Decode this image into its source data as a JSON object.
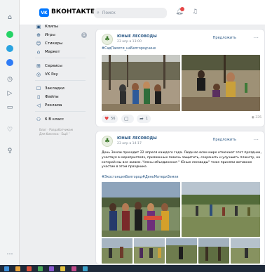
{
  "header": {
    "logo_mark": "VK",
    "logo_text": "ВКОНТАКТЕ",
    "search_placeholder": "Поиск",
    "icons": [
      "search-icon",
      "bell-icon",
      "music-icon"
    ]
  },
  "left_menu": {
    "items": [
      {
        "label": "Клипы",
        "icon": "clips-icon"
      },
      {
        "label": "Игры",
        "icon": "gamepad-icon",
        "badge": "1"
      },
      {
        "label": "Стикеры",
        "icon": "sticker-icon"
      },
      {
        "label": "Маркет",
        "icon": "market-icon"
      },
      {
        "label": "Сервисы",
        "icon": "services-icon"
      },
      {
        "label": "VK Pay",
        "icon": "vkpay-icon"
      },
      {
        "label": "Закладки",
        "icon": "bookmark-icon"
      },
      {
        "label": "Файлы",
        "icon": "file-icon"
      },
      {
        "label": "Реклама",
        "icon": "ads-icon"
      },
      {
        "label": "6 В класс",
        "icon": "group-icon"
      }
    ],
    "footer": "Блог · Разработчикам\nДля бизнеса · Ещё ˅"
  },
  "posts": [
    {
      "author": "ЮНЫЕ ЛЕСОВОДЫ",
      "date": "23 апр в 13:00",
      "suggest_label": "Предложить",
      "tags": "#СадПамяти_наБелгородчине",
      "text": "",
      "likes": "56",
      "comments": "",
      "shares": "1",
      "views": "335"
    },
    {
      "author": "ЮНЫЕ ЛЕСОВОДЫ",
      "date": "23 апр в 14:17",
      "suggest_label": "Предложить",
      "text": "День Земли проходит 22 апреля каждого года. Люди во всем мире отмечают этот праздник, участвуя в мероприятиях, призванных помочь защитить, сохранить и улучшить планету, на которой мы все живем. Члены объединения \" Юные лесоводы\" тоже приняли активное участие в этом празднике.",
      "tags": "#ЭкостанцияБелгород#ДеньМатериЗемли"
    }
  ],
  "colors": {
    "vk_blue": "#0077ff",
    "link": "#2a5885",
    "like_red": "#e64646",
    "page_bg": "#edeef0"
  }
}
